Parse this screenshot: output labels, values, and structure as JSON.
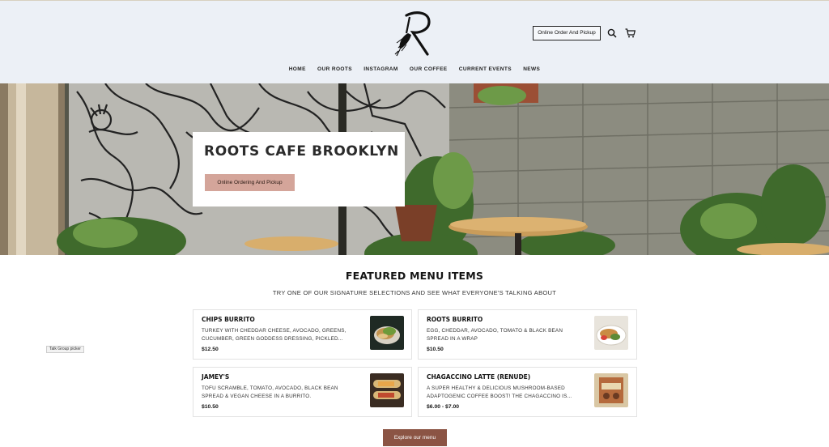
{
  "header": {
    "order_button": "Online Order And Pickup",
    "nav": [
      "HOME",
      "OUR ROOTS",
      "INSTAGRAM",
      "OUR COFFEE",
      "CURRENT EVENTS",
      "NEWS"
    ]
  },
  "hero": {
    "title": "ROOTS CAFE BROOKLYN",
    "button": "Online Ordering And Pickup"
  },
  "featured": {
    "title": "FEATURED MENU ITEMS",
    "subtitle": "TRY ONE OF OUR SIGNATURE SELECTIONS AND SEE WHAT EVERYONE'S TALKING ABOUT",
    "items": [
      {
        "name": "CHIPS BURRITO",
        "description": "TURKEY WITH CHEDDAR CHEESE, AVOCADO, GREENS, CUCUMBER, GREEN GODDESS DRESSING, PICKLED...",
        "price": "$12.50"
      },
      {
        "name": "ROOTS BURRITO",
        "description": "EGG, CHEDDAR, AVOCADO, TOMATO & BLACK BEAN SPREAD IN A WRAP",
        "price": "$10.50"
      },
      {
        "name": "JAMEY'S",
        "description": "TOFU SCRAMBLE, TOMATO, AVOCADO, BLACK BEAN SPREAD & VEGAN CHEESE IN A BURRITO.",
        "price": "$10.50"
      },
      {
        "name": "CHAGACCINO LATTE (RENUDE)",
        "description": "A SUPER HEALTHY & DELICIOUS MUSHROOM-BASED ADAPTOGENIC COFFEE BOOST! THE CHAGACCINO IS...",
        "price": "$6.00 - $7.00"
      }
    ],
    "explore_button": "Explore our menu"
  },
  "tooltip": "Talk Group picker",
  "colors": {
    "header_bg": "#ecf0f6",
    "hero_button": "#d4a59a",
    "explore_button": "#8b5444"
  },
  "icons": [
    "roots-logo",
    "search-icon",
    "cart-icon"
  ]
}
